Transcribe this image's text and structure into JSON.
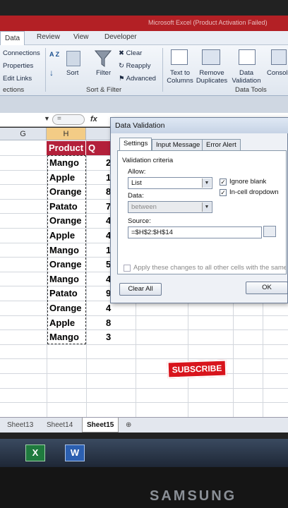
{
  "window": {
    "title": "Microsoft Excel (Product Activation Failed)"
  },
  "ribbon_tabs": [
    "Data",
    "Review",
    "View",
    "Developer"
  ],
  "ribbon": {
    "connections": "Connections",
    "properties": "Properties",
    "edit_links": "Edit Links",
    "connections_group": "ections",
    "sort_az": "A Z",
    "sort": "Sort",
    "filter": "Filter",
    "clear": "Clear",
    "reapply": "Reapply",
    "advanced": "Advanced",
    "sort_filter_group": "Sort & Filter",
    "text_to_columns": "Text to Columns",
    "remove_duplicates": "Remove Duplicates",
    "data_validation": "Data Validation",
    "consolidate": "Consol",
    "data_tools_group": "Data Tools"
  },
  "formula_bar": {
    "fx": "fx",
    "value": "="
  },
  "columns": [
    "G",
    "H"
  ],
  "table": {
    "header_product": "Product",
    "header_q": "Q",
    "products": [
      "Mango",
      "Apple",
      "Orange",
      "Patato",
      "Orange",
      "Apple",
      "Mango",
      "Orange",
      "Mango",
      "Patato",
      "Orange",
      "Apple",
      "Mango"
    ],
    "quantities": [
      "2",
      "1",
      "8",
      "7",
      "4",
      "4",
      "1",
      "5",
      "4",
      "9",
      "4",
      "8",
      "3"
    ]
  },
  "dialog": {
    "title": "Data Validation",
    "tabs": [
      "Settings",
      "Input Message",
      "Error Alert"
    ],
    "criteria_label": "Validation criteria",
    "allow_label": "Allow:",
    "allow_value": "List",
    "data_label": "Data:",
    "data_value": "between",
    "ignore_blank": "Ignore blank",
    "in_cell_dropdown": "In-cell dropdown",
    "source_label": "Source:",
    "source_value": "=$H$2:$H$14",
    "apply_all": "Apply these changes to all other cells with the same settings",
    "clear_all": "Clear All",
    "ok": "OK"
  },
  "sheet_tabs": [
    "Sheet13",
    "Sheet14",
    "Sheet15"
  ],
  "overlay": {
    "subscribe": "SUBSCRIBE"
  },
  "device": {
    "brand": "SAMSUNG"
  }
}
